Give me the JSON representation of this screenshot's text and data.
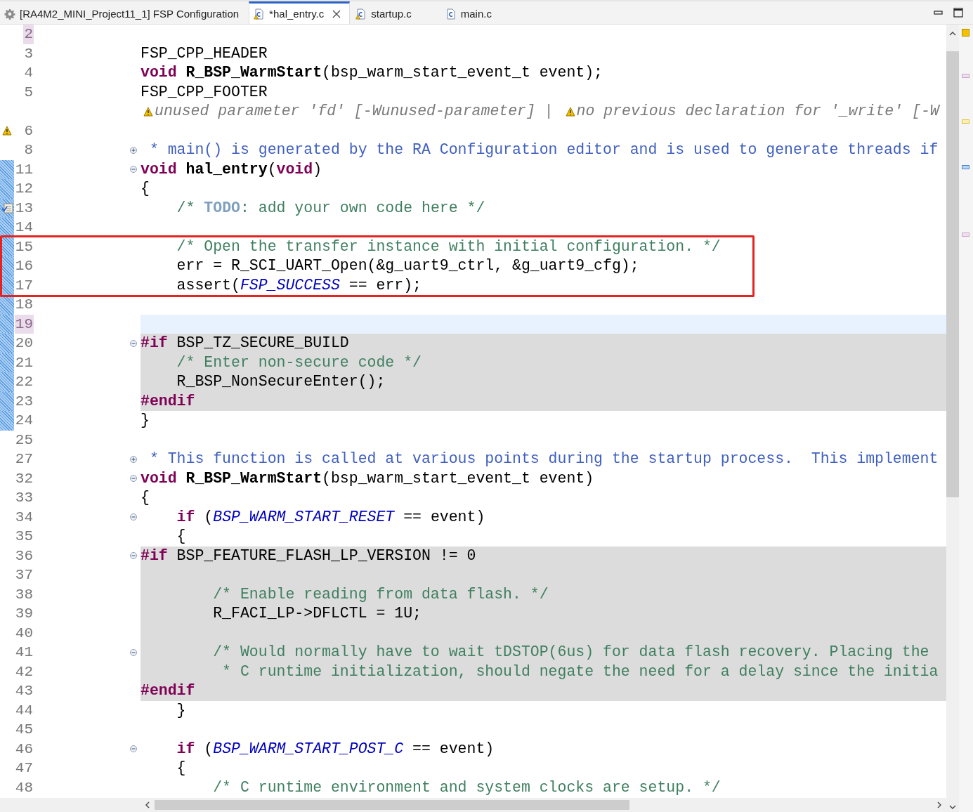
{
  "tabs": [
    {
      "label": "[RA4M2_MINI_Project11_1] FSP Configuration",
      "kind": "config",
      "selected": false
    },
    {
      "label": "*hal_entry.c",
      "kind": "source",
      "selected": true
    },
    {
      "label": "startup.c",
      "kind": "source",
      "selected": false
    },
    {
      "label": "main.c",
      "kind": "plain",
      "selected": false
    }
  ],
  "lines": [
    {
      "number": "2",
      "marked": true
    },
    {
      "number": "3",
      "tokens": [
        {
          "kind": "text",
          "text": "FSP_CPP_HEADER"
        }
      ]
    },
    {
      "number": "4",
      "tokens": [
        {
          "kind": "kw",
          "text": "void"
        },
        {
          "kind": "fn",
          "text": " R_BSP_WarmStart"
        },
        {
          "kind": "text",
          "text": "(bsp_warm_start_event_t event);"
        }
      ]
    },
    {
      "number": "5",
      "tokens": [
        {
          "kind": "text",
          "text": "FSP_CPP_FOOTER"
        }
      ]
    },
    {
      "kind": "annotation",
      "tokens": [
        {
          "kind": "warning",
          "text": "unused parameter 'fd' [-Wunused-parameter]"
        },
        {
          "kind": "muted",
          "text": " | "
        },
        {
          "kind": "warning",
          "text": "no previous declaration for '_write' [-W"
        }
      ]
    },
    {
      "number": "6",
      "warning": true
    },
    {
      "number": "8",
      "foldable": true,
      "expanded": false,
      "tokens": [
        {
          "kind": "doc",
          "text": " * main() is generated by the RA Configuration editor and is used to generate threads if"
        }
      ]
    },
    {
      "number": "11",
      "foldable": true,
      "expanded": true,
      "changed": true,
      "tokens": [
        {
          "kind": "kw",
          "text": "void"
        },
        {
          "kind": "fn",
          "text": " hal_entry"
        },
        {
          "kind": "text",
          "text": "("
        },
        {
          "kind": "kw",
          "text": "void"
        },
        {
          "kind": "text",
          "text": ")"
        }
      ]
    },
    {
      "number": "12",
      "changed": true,
      "tokens": [
        {
          "kind": "text",
          "text": "{"
        }
      ]
    },
    {
      "number": "13",
      "changed": true,
      "task": true,
      "tokens": [
        {
          "kind": "comment",
          "text": "    /* "
        },
        {
          "kind": "todo",
          "text": "TODO"
        },
        {
          "kind": "comment",
          "text": ": add your own code here */"
        }
      ]
    },
    {
      "number": "14",
      "changed": true
    },
    {
      "number": "15",
      "changed": true,
      "boxed": true,
      "tokens": [
        {
          "kind": "comment",
          "text": "    /* Open the transfer instance with initial configuration. */"
        }
      ]
    },
    {
      "number": "16",
      "changed": true,
      "boxed": true,
      "tokens": [
        {
          "kind": "text",
          "text": "    err = R_SCI_UART_Open(&g_uart9_ctrl, &g_uart9_cfg);"
        }
      ]
    },
    {
      "number": "17",
      "changed": true,
      "boxed": true,
      "tokens": [
        {
          "kind": "text",
          "text": "    assert("
        },
        {
          "kind": "const",
          "text": "FSP_SUCCESS"
        },
        {
          "kind": "text",
          "text": " == err);"
        }
      ]
    },
    {
      "number": "18",
      "changed": true
    },
    {
      "number": "19",
      "changed": true,
      "marked": true,
      "current": true
    },
    {
      "number": "20",
      "changed": true,
      "foldable": true,
      "expanded": true,
      "shaded": true,
      "tokens": [
        {
          "kind": "kw",
          "text": "#if"
        },
        {
          "kind": "text",
          "text": " BSP_TZ_SECURE_BUILD"
        }
      ]
    },
    {
      "number": "21",
      "changed": true,
      "shaded": true,
      "tokens": [
        {
          "kind": "comment",
          "text": "    /* Enter non-secure code */"
        }
      ]
    },
    {
      "number": "22",
      "changed": true,
      "shaded": true,
      "tokens": [
        {
          "kind": "text",
          "text": "    R_BSP_NonSecureEnter();"
        }
      ]
    },
    {
      "number": "23",
      "changed": true,
      "shaded": true,
      "tokens": [
        {
          "kind": "kw",
          "text": "#endif"
        }
      ]
    },
    {
      "number": "24",
      "changed": true,
      "tokens": [
        {
          "kind": "text",
          "text": "}"
        }
      ]
    },
    {
      "number": "25"
    },
    {
      "number": "27",
      "foldable": true,
      "expanded": false,
      "tokens": [
        {
          "kind": "doc",
          "text": " * This function is called at various points during the startup process.  This implement"
        }
      ]
    },
    {
      "number": "32",
      "foldable": true,
      "expanded": true,
      "tokens": [
        {
          "kind": "kw",
          "text": "void"
        },
        {
          "kind": "fn",
          "text": " R_BSP_WarmStart"
        },
        {
          "kind": "text",
          "text": "(bsp_warm_start_event_t event)"
        }
      ]
    },
    {
      "number": "33",
      "tokens": [
        {
          "kind": "text",
          "text": "{"
        }
      ]
    },
    {
      "number": "34",
      "foldable": true,
      "expanded": true,
      "tokens": [
        {
          "kind": "kw",
          "text": "    if"
        },
        {
          "kind": "text",
          "text": " ("
        },
        {
          "kind": "const",
          "text": "BSP_WARM_START_RESET"
        },
        {
          "kind": "text",
          "text": " == event)"
        }
      ]
    },
    {
      "number": "35",
      "tokens": [
        {
          "kind": "text",
          "text": "    {"
        }
      ]
    },
    {
      "number": "36",
      "foldable": true,
      "expanded": true,
      "shaded": true,
      "tokens": [
        {
          "kind": "kw",
          "text": "#if"
        },
        {
          "kind": "text",
          "text": " BSP_FEATURE_FLASH_LP_VERSION != 0"
        }
      ]
    },
    {
      "number": "37",
      "shaded": true
    },
    {
      "number": "38",
      "shaded": true,
      "tokens": [
        {
          "kind": "comment",
          "text": "        /* Enable reading from data flash. */"
        }
      ]
    },
    {
      "number": "39",
      "shaded": true,
      "tokens": [
        {
          "kind": "text",
          "text": "        R_FACI_LP->DFLCTL = 1U;"
        }
      ]
    },
    {
      "number": "40",
      "shaded": true
    },
    {
      "number": "41",
      "foldable": true,
      "expanded": true,
      "shaded": true,
      "tokens": [
        {
          "kind": "comment",
          "text": "        /* Would normally have to wait tDSTOP(6us) for data flash recovery. Placing the"
        }
      ]
    },
    {
      "number": "42",
      "shaded": true,
      "tokens": [
        {
          "kind": "comment",
          "text": "         * C runtime initialization, should negate the need for a delay since the initia"
        }
      ]
    },
    {
      "number": "43",
      "shaded": true,
      "tokens": [
        {
          "kind": "kw",
          "text": "#endif"
        }
      ]
    },
    {
      "number": "44",
      "tokens": [
        {
          "kind": "text",
          "text": "    }"
        }
      ]
    },
    {
      "number": "45"
    },
    {
      "number": "46",
      "foldable": true,
      "expanded": true,
      "tokens": [
        {
          "kind": "kw",
          "text": "    if"
        },
        {
          "kind": "text",
          "text": " ("
        },
        {
          "kind": "const",
          "text": "BSP_WARM_START_POST_C"
        },
        {
          "kind": "text",
          "text": " == event)"
        }
      ]
    },
    {
      "number": "47",
      "tokens": [
        {
          "kind": "text",
          "text": "    {"
        }
      ]
    },
    {
      "number": "48",
      "tokens": [
        {
          "kind": "comment",
          "text": "        /* C runtime environment and system clocks are setup. */"
        }
      ]
    }
  ]
}
